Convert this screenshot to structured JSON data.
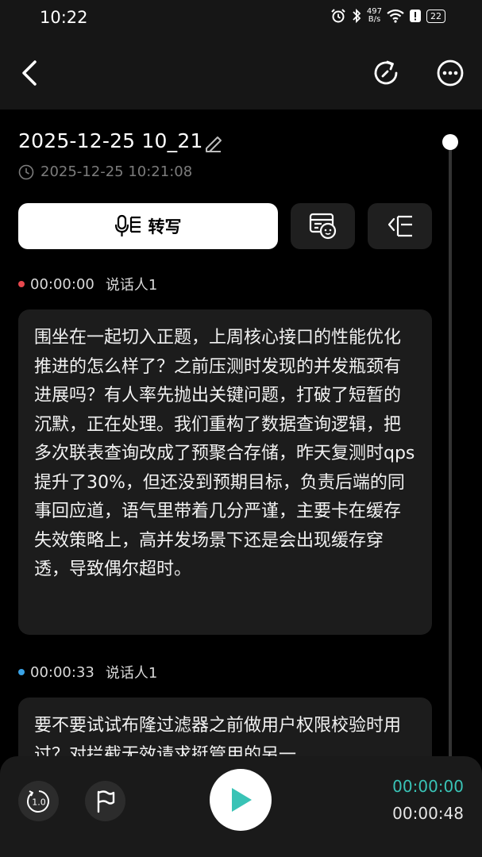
{
  "status_bar": {
    "time": "10:22",
    "net_speed_value": "497",
    "net_speed_unit": "B/s",
    "battery": "22"
  },
  "recording": {
    "title": "2025-12-25 10_21",
    "timestamp": "2025-12-25 10:21:08"
  },
  "actions": {
    "transcribe_label": "转写"
  },
  "segments": [
    {
      "time": "00:00:00",
      "speaker": "说话人1",
      "dot_color": "#e8484e",
      "text": "围坐在一起切入正题，上周核心接口的性能优化推进的怎么样了？之前压测时发现的并发瓶颈有进展吗？有人率先抛出关键问题，打破了短暂的沉默，正在处理。我们重构了数据查询逻辑，把多次联表查询改成了预聚合存储，昨天复测时qps提升了30%，但还没到预期目标，负责后端的同事回应道，语气里带着几分严谨，主要卡在缓存失效策略上，高并发场景下还是会出现缓存穿透，导致偶尔超时。"
    },
    {
      "time": "00:00:33",
      "speaker": "说话人1",
      "dot_color": "#3aa3e6",
      "text": "要不要试试布隆过滤器之前做用户权限校验时用过？对拦截无效请求挺管用的另一"
    }
  ],
  "player": {
    "speed_label": "1.0",
    "current_time": "00:00:00",
    "total_time": "00:00:48"
  },
  "colors": {
    "accent": "#39c3b6",
    "background": "#000000",
    "card": "#1c1c1c"
  }
}
